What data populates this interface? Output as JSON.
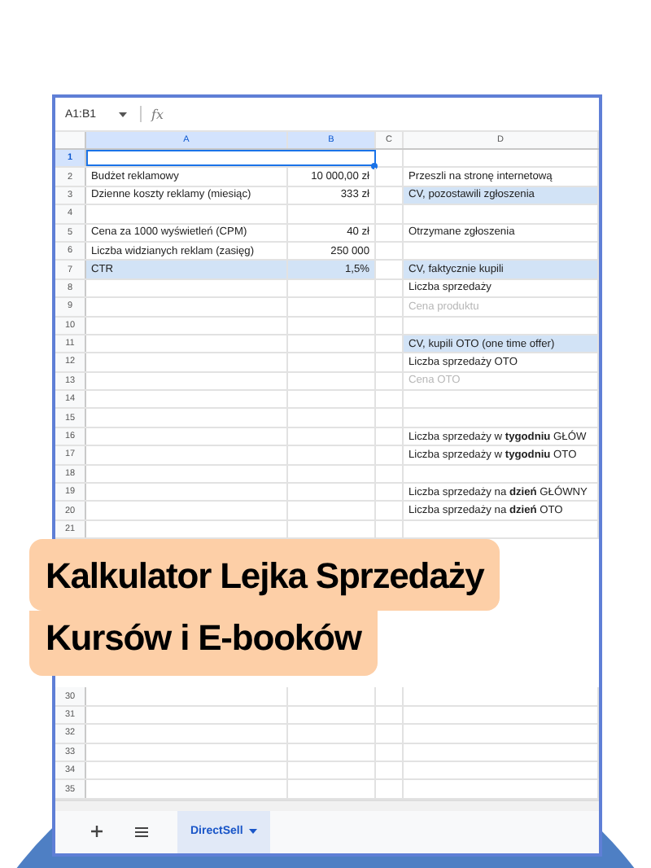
{
  "sheet": {
    "name_box": "A1:B1",
    "formula_label": "fx",
    "columns": [
      {
        "label": "A",
        "selected": true
      },
      {
        "label": "B",
        "selected": true
      },
      {
        "label": "C",
        "selected": false
      },
      {
        "label": "D",
        "selected": false
      }
    ],
    "rows": [
      {
        "number": "1",
        "selected": true
      },
      {
        "number": "2",
        "selected": false,
        "a": {
          "text": "Budżet reklamowy",
          "highlighted": false
        },
        "b": {
          "text": "10 000,00 zł",
          "highlighted": false
        },
        "d": {
          "text": "Przeszli na stronę internetową",
          "highlighted": false,
          "muted": false
        }
      },
      {
        "number": "3",
        "selected": false,
        "a": {
          "text": "Dzienne koszty reklamy (miesiąc)",
          "highlighted": false
        },
        "b": {
          "text": "333 zł",
          "highlighted": false
        },
        "d": {
          "text": "CV, pozostawili zgłoszenia",
          "highlighted": true,
          "muted": false
        }
      },
      {
        "number": "4",
        "selected": false
      },
      {
        "number": "5",
        "selected": false,
        "a": {
          "text": "Cena za 1000 wyświetleń (CPM)",
          "highlighted": false
        },
        "b": {
          "text": "40 zł",
          "highlighted": false
        },
        "d": {
          "text": "Otrzymane zgłoszenia",
          "highlighted": false,
          "muted": false
        }
      },
      {
        "number": "6",
        "selected": false,
        "a": {
          "text": "Liczba widzianych reklam (zasięg)",
          "highlighted": false
        },
        "b": {
          "text": "250 000",
          "highlighted": false
        }
      },
      {
        "number": "7",
        "selected": false,
        "a": {
          "text": "CTR",
          "highlighted": true
        },
        "b": {
          "text": "1,5%",
          "highlighted": true
        },
        "d": {
          "text": "CV, faktycznie kupili",
          "highlighted": true,
          "muted": false
        }
      },
      {
        "number": "8",
        "selected": false,
        "d": {
          "text": "Liczba sprzedaży",
          "highlighted": false,
          "muted": false
        }
      },
      {
        "number": "9",
        "selected": false,
        "d": {
          "text": "Cena produktu",
          "highlighted": false,
          "muted": true
        }
      },
      {
        "number": "10",
        "selected": false
      },
      {
        "number": "11",
        "selected": false,
        "d": {
          "text": "CV, kupili OTO (one time offer)",
          "highlighted": true,
          "muted": false
        }
      },
      {
        "number": "12",
        "selected": false,
        "d": {
          "text": "Liczba sprzedaży OTO",
          "highlighted": false,
          "muted": false
        }
      },
      {
        "number": "13",
        "selected": false,
        "d": {
          "text": "Cena OTO",
          "highlighted": false,
          "muted": true
        }
      },
      {
        "number": "14",
        "selected": false
      },
      {
        "number": "15",
        "selected": false
      },
      {
        "number": "16",
        "selected": false,
        "d": {
          "text": "Liczba sprzedaży w **tygodniu** GŁÓW",
          "highlighted": false,
          "muted": false
        }
      },
      {
        "number": "17",
        "selected": false,
        "d": {
          "text": "Liczba sprzedaży w **tygodniu** OTO",
          "highlighted": false,
          "muted": false
        }
      },
      {
        "number": "18",
        "selected": false
      },
      {
        "number": "19",
        "selected": false,
        "d": {
          "text": "Liczba sprzedaży na **dzień** GŁÓWNY",
          "highlighted": false,
          "muted": false
        }
      },
      {
        "number": "20",
        "selected": false,
        "d": {
          "text": "Liczba sprzedaży na **dzień** OTO",
          "highlighted": false,
          "muted": false
        }
      },
      {
        "number": "21",
        "selected": false
      }
    ],
    "banner": {
      "title_lines": [
        "Kalkulator Lejka Sprzedaży",
        "Kursów i E-booków"
      ]
    },
    "rows_below": [
      {
        "number": "30",
        "selected": false
      },
      {
        "number": "31",
        "selected": false
      },
      {
        "number": "32",
        "selected": false
      },
      {
        "number": "33",
        "selected": false
      },
      {
        "number": "34",
        "selected": false
      },
      {
        "number": "35",
        "selected": false
      }
    ],
    "tabs": [
      {
        "label": "DirectSell",
        "selected": true
      }
    ]
  }
}
